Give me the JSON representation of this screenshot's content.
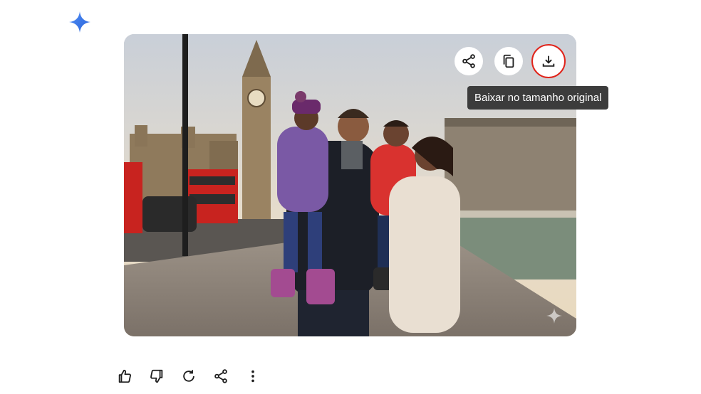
{
  "assistant": {
    "logo_icon": "gemini-sparkle-icon",
    "logo_color": "#4285f4"
  },
  "image_card": {
    "description_icon": "generated-family-photo",
    "buttons": [
      {
        "icon": "share-icon"
      },
      {
        "icon": "copy-icon"
      },
      {
        "icon": "download-icon",
        "highlight_color": "#e0241b"
      }
    ],
    "tooltip": "Baixar no tamanho original",
    "watermark_icon": "sparkle-watermark-icon"
  },
  "response_actions": [
    {
      "icon": "thumbs-up-icon"
    },
    {
      "icon": "thumbs-down-icon"
    },
    {
      "icon": "regenerate-icon"
    },
    {
      "icon": "share-icon"
    },
    {
      "icon": "more-options-icon"
    }
  ]
}
